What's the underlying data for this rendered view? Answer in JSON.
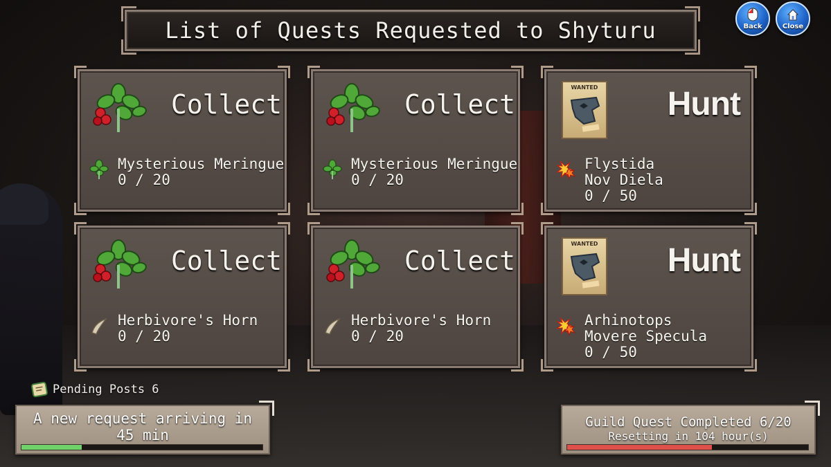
{
  "title": "List of Quests Requested to Shyturu",
  "buttons": {
    "back": "Back",
    "close": "Close"
  },
  "quests": [
    {
      "type": "Collect",
      "item": "Mysterious Meringue",
      "progress": "0 / 20"
    },
    {
      "type": "Collect",
      "item": "Mysterious Meringue",
      "progress": "0 / 20"
    },
    {
      "type": "Hunt",
      "poster": "WANTED",
      "target": "Flystida",
      "region": "Nov Diela",
      "progress": "0 / 50"
    },
    {
      "type": "Collect",
      "item": "Herbivore's Horn",
      "progress": "0 / 20"
    },
    {
      "type": "Collect",
      "item": "Herbivore's Horn",
      "progress": "0 / 20"
    },
    {
      "type": "Hunt",
      "poster": "WANTED",
      "target": "Arhinotops",
      "region": "Movere Specula",
      "progress": "0 / 50"
    }
  ],
  "pending": {
    "label": "Pending Posts 6"
  },
  "arrival": {
    "line1": "A new request arriving in",
    "line2": "45 min",
    "progress": 0.25,
    "bar_color": "#6fd36a"
  },
  "guild": {
    "line1": "Guild Quest Completed 6/20",
    "line2": "Resetting in 104 hour(s)",
    "progress": 0.6,
    "bar_color": "#e0504a"
  }
}
